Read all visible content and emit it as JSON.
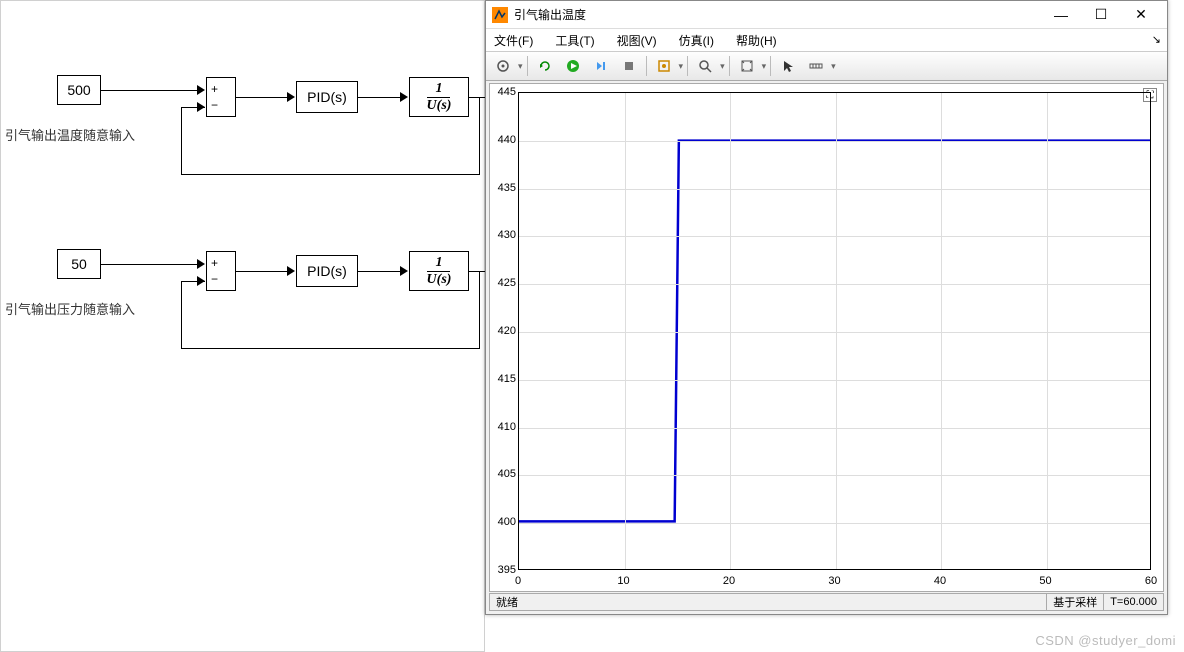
{
  "simulink": {
    "block1_value": "500",
    "block1_label": "引气输出温度随意输入",
    "block2_value": "50",
    "block2_label": "引气输出压力随意输入",
    "pid_label": "PID(s)",
    "frac_top": "1",
    "frac_bot": "U(s)"
  },
  "scope": {
    "title": "引气输出温度",
    "menu": {
      "file": "文件(F)",
      "tools": "工具(T)",
      "view": "视图(V)",
      "sim": "仿真(I)",
      "help": "帮助(H)"
    },
    "status_left": "就绪",
    "status_sample": "基于采样",
    "status_time": "T=60.000"
  },
  "watermark": "CSDN @studyer_domi",
  "chart_data": {
    "type": "line",
    "title": "",
    "xlabel": "",
    "ylabel": "",
    "xlim": [
      0,
      60
    ],
    "ylim": [
      395,
      445
    ],
    "xticks": [
      0,
      10,
      20,
      30,
      40,
      50,
      60
    ],
    "yticks": [
      395,
      400,
      405,
      410,
      415,
      420,
      425,
      430,
      435,
      440,
      445
    ],
    "series": [
      {
        "name": "引气输出温度",
        "color": "#0000d0",
        "x": [
          0,
          14,
          14.8,
          15.2,
          16,
          60
        ],
        "y": [
          400,
          400,
          400,
          440,
          440,
          440
        ]
      }
    ]
  }
}
